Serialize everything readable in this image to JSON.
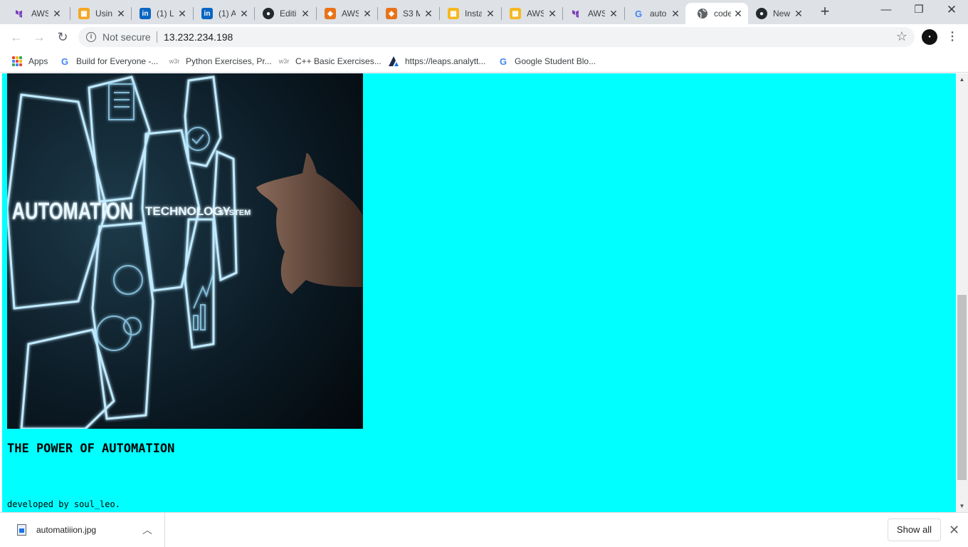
{
  "tabs": [
    {
      "title": "AWS",
      "icon": "terraform-icon",
      "color": "#7b42bc"
    },
    {
      "title": "Usin",
      "icon": "aws-box-icon",
      "color": "#f5a623"
    },
    {
      "title": "(1) L",
      "icon": "linkedin-icon",
      "color": "#0a66c2"
    },
    {
      "title": "(1) A",
      "icon": "linkedin-icon",
      "color": "#0a66c2"
    },
    {
      "title": "Editi",
      "icon": "github-icon",
      "color": "#24292e"
    },
    {
      "title": "AWS",
      "icon": "aws-cube-icon",
      "color": "#e8731a"
    },
    {
      "title": "S3 M",
      "icon": "aws-cube-icon",
      "color": "#e8731a"
    },
    {
      "title": "Insta",
      "icon": "aws-box-icon",
      "color": "#f5b81e"
    },
    {
      "title": "AWS",
      "icon": "aws-box-icon",
      "color": "#f5b81e"
    },
    {
      "title": "AWS",
      "icon": "terraform-icon",
      "color": "#7b42bc"
    },
    {
      "title": "auto",
      "icon": "google-icon",
      "color": "#4285f4"
    },
    {
      "title": "code",
      "icon": "globe-icon",
      "color": "#5f6368"
    },
    {
      "title": "New",
      "icon": "github-icon",
      "color": "#24292e"
    }
  ],
  "toolbar": {
    "security_label": "Not secure",
    "url": "13.232.234.198"
  },
  "bookmarks": [
    {
      "label": "Apps",
      "icon": "apps-grid-icon"
    },
    {
      "label": "Build for Everyone -...",
      "icon": "google-icon"
    },
    {
      "label": "Python Exercises, Pr...",
      "icon": "w3r-icon"
    },
    {
      "label": "C++ Basic Exercises...",
      "icon": "w3r-icon"
    },
    {
      "label": "https://leaps.analytt...",
      "icon": "analytics-a-icon"
    },
    {
      "label": "Google Student Blo...",
      "icon": "google-icon"
    }
  ],
  "page": {
    "background": "#00ffff",
    "image_text": {
      "automation": "AUTOMATION",
      "technology": "TECHNOLOGY",
      "system": "SYSTEM"
    },
    "heading": "THE POWER OF AUTOMATION",
    "footer": "developed by soul_leo."
  },
  "download_shelf": {
    "filename": "automatiiion.jpg",
    "show_all_label": "Show all"
  }
}
